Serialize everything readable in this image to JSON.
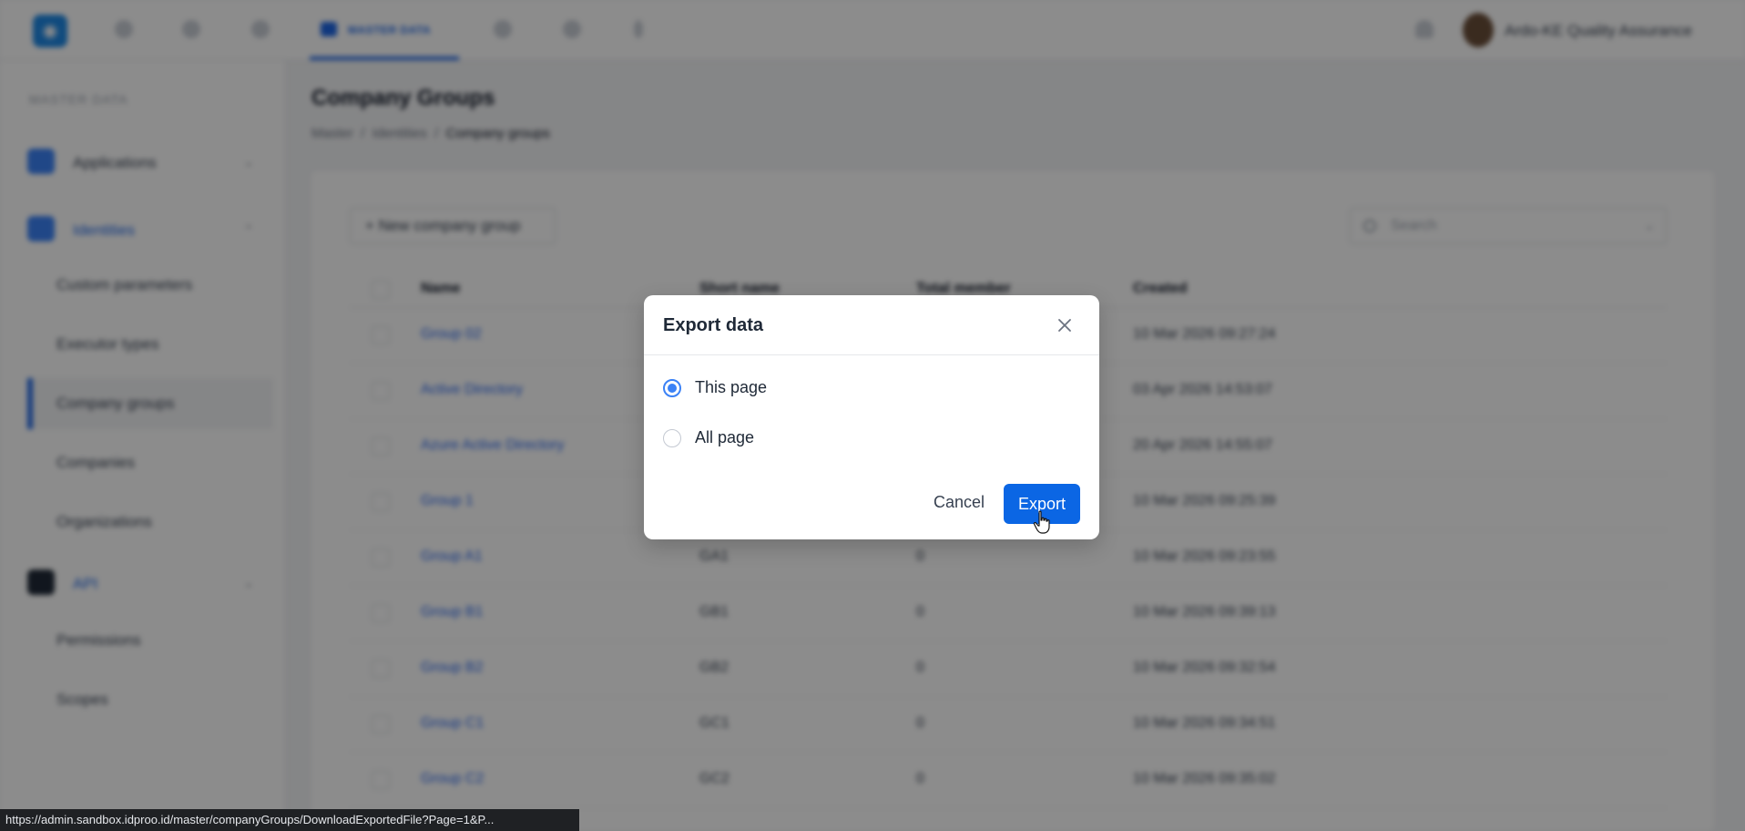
{
  "topbar": {
    "active_tab": "MASTER DATA",
    "user_name": "Ardo-KE Quality Assurance"
  },
  "sidebar": {
    "section_label": "MASTER DATA",
    "groups": [
      {
        "label": "Applications",
        "icon": "applications-icon"
      },
      {
        "label": "Identities",
        "icon": "shield-icon"
      },
      {
        "label": "API",
        "icon": "api-icon"
      }
    ],
    "items": [
      "Custom parameters",
      "Executor types",
      "Company groups",
      "Companies",
      "Organizations",
      "Permissions",
      "Scopes"
    ],
    "selected_item": "Company groups"
  },
  "page": {
    "title": "Company Groups",
    "breadcrumb": [
      "Master",
      "Identities",
      "Company groups"
    ],
    "breadcrumb_sep": "/"
  },
  "toolbar": {
    "new_button": "+ New company group",
    "search_placeholder": "Search"
  },
  "table": {
    "columns": [
      "Name",
      "Short name",
      "Total member",
      "Created"
    ],
    "rows": [
      {
        "name": "Group 02",
        "short": "",
        "members": "",
        "created": "10 Mar 2026 09:27:24"
      },
      {
        "name": "Active Directory",
        "short": "",
        "members": "",
        "created": "03 Apr 2026 14:53:07"
      },
      {
        "name": "Azure Active Directory",
        "short": "",
        "members": "",
        "created": "20 Apr 2026 14:55:07"
      },
      {
        "name": "Group 1",
        "short": "",
        "members": "",
        "created": "10 Mar 2026 09:25:39"
      },
      {
        "name": "Group A1",
        "short": "GA1",
        "members": "0",
        "created": "10 Mar 2026 09:23:55"
      },
      {
        "name": "Group B1",
        "short": "GB1",
        "members": "0",
        "created": "10 Mar 2026 09:39:13"
      },
      {
        "name": "Group B2",
        "short": "GB2",
        "members": "0",
        "created": "10 Mar 2026 09:32:54"
      },
      {
        "name": "Group C1",
        "short": "GC1",
        "members": "0",
        "created": "10 Mar 2026 09:34:51"
      },
      {
        "name": "Group C2",
        "short": "GC2",
        "members": "0",
        "created": "10 Mar 2026 09:35:02"
      }
    ]
  },
  "modal": {
    "title": "Export data",
    "options": [
      {
        "label": "This page",
        "checked": true
      },
      {
        "label": "All page",
        "checked": false
      }
    ],
    "cancel_label": "Cancel",
    "export_label": "Export"
  },
  "status_url": "https://admin.sandbox.idproo.id/master/companyGroups/DownloadExportedFile?Page=1&P...",
  "colors": {
    "primary": "#0b66e4",
    "radio_accent": "#3b82f6",
    "overlay": "rgba(0,0,0,0.45)"
  }
}
